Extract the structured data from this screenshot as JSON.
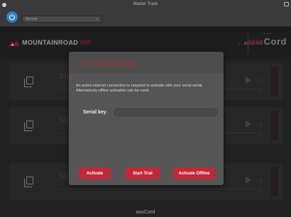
{
  "host": {
    "title": "Master Track",
    "preset": "Manual"
  },
  "plugin": {
    "brand": "MOUNTAINROAD",
    "brand_suffix": "DSP",
    "product_select": "auxCord",
    "logo_word_a": "aux",
    "logo_word_b": "Cord"
  },
  "slots": [
    {
      "title": "Slo",
      "time": "-00"
    },
    {
      "title": "Slo",
      "time": "-00"
    },
    {
      "title": "Slo",
      "time": "-00"
    }
  ],
  "dialog": {
    "title": "ACTIVATE LICENSE",
    "message": "An active internet connection is required to activate with your serial serial. Alternatively offline activation can be used.",
    "serial_label": "Serial key",
    "serial_value": "",
    "buttons": {
      "activate": "Activate",
      "trial": "Start Trial",
      "offline": "Activate Offline"
    }
  },
  "footer": "auxCord",
  "colors": {
    "accent": "#c0283a",
    "power": "#2a83c6"
  }
}
